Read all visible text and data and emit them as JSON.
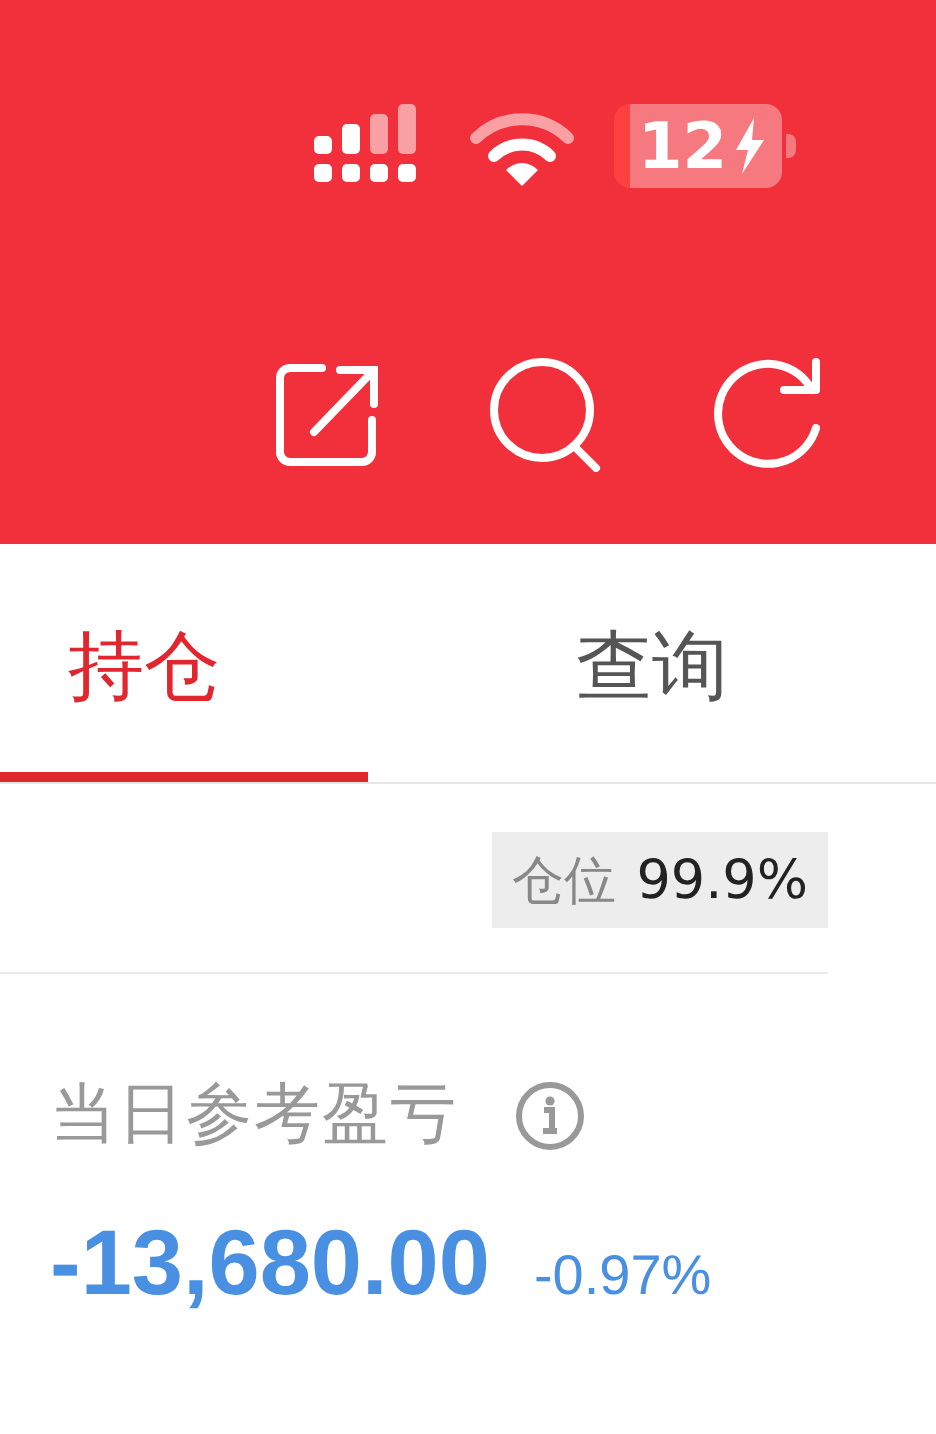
{
  "status_bar": {
    "battery": "12"
  },
  "tabs": [
    {
      "label": "持仓",
      "selected": true
    },
    {
      "label": "查询",
      "selected": false
    }
  ],
  "position": {
    "label": "仓位",
    "value": "99.9%"
  },
  "pnl": {
    "label": "当日参考盈亏",
    "value": "-13,680.00",
    "percent": "-0.97%"
  }
}
